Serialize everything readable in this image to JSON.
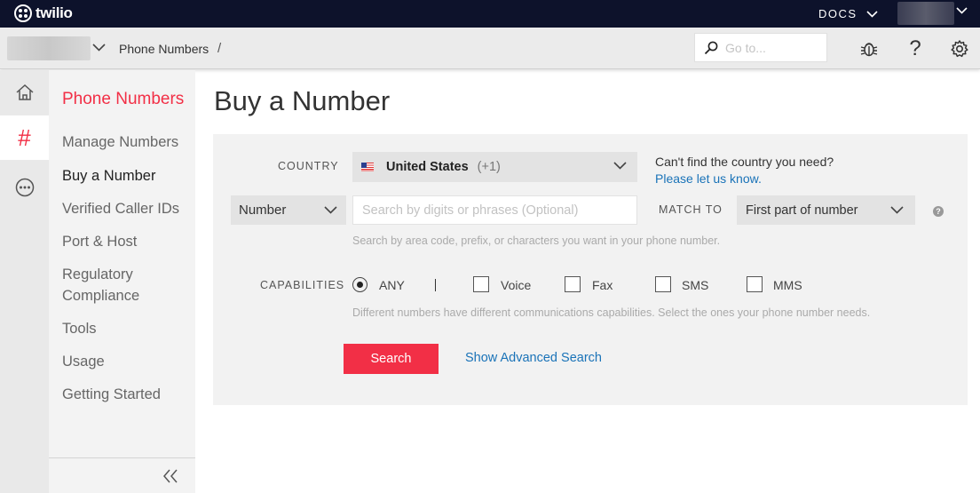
{
  "topbar": {
    "logo_text": "twilio",
    "docs_label": "DOCS"
  },
  "subbar": {
    "breadcrumb": "Phone Numbers",
    "breadcrumb_sep": "/",
    "goto_placeholder": "Go to..."
  },
  "sidenav": {
    "title": "Phone Numbers",
    "items": [
      {
        "label": "Manage Numbers"
      },
      {
        "label": "Buy a Number"
      },
      {
        "label": "Verified Caller IDs"
      },
      {
        "label": "Port & Host"
      },
      {
        "label": "Regulatory"
      },
      {
        "label": "Compliance"
      },
      {
        "label": "Tools"
      },
      {
        "label": "Usage"
      },
      {
        "label": "Getting Started"
      }
    ]
  },
  "rail": {
    "hash_glyph": "#"
  },
  "main": {
    "title": "Buy a Number",
    "country_label": "COUNTRY",
    "country_name": "United States",
    "country_code": "(+1)",
    "help_question": "Can't find the country you need?",
    "help_link": "Please let us know.",
    "type_select": "Number",
    "search_placeholder": "Search by digits or phrases (Optional)",
    "match_label": "MATCH TO",
    "match_select": "First part of number",
    "help_icon": "?",
    "search_hint": "Search by area code, prefix, or characters you want in your phone number.",
    "capabilities_label": "CAPABILITIES",
    "capabilities": {
      "any": "ANY",
      "voice": "Voice",
      "fax": "Fax",
      "sms": "SMS",
      "mms": "MMS"
    },
    "capabilities_hint": "Different numbers have different communications capabilities. Select the ones your phone number needs.",
    "search_button": "Search",
    "advanced_link": "Show Advanced Search"
  },
  "colors": {
    "accent": "#f22f46",
    "topbar": "#0d122b",
    "link": "#1a73b8"
  },
  "icons": [
    "home-icon",
    "hash-icon",
    "more-icon",
    "search-icon",
    "bug-icon",
    "help-icon",
    "gear-icon",
    "chevron-down-icon",
    "collapse-icon"
  ]
}
